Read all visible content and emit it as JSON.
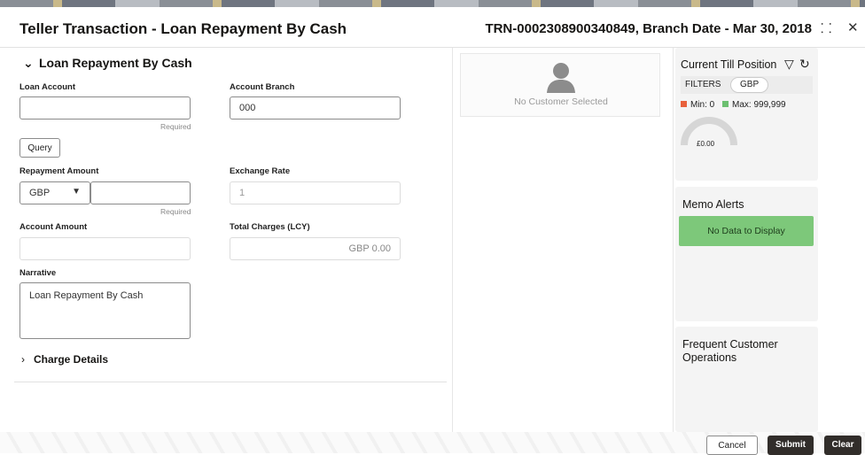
{
  "header": {
    "title": "Teller Transaction - Loan Repayment By Cash",
    "subtitle": "TRN-0002308900340849, Branch Date - Mar 30, 2018"
  },
  "form": {
    "section_title": "Loan Repayment By Cash",
    "loan_account_label": "Loan Account",
    "loan_account_value": "",
    "loan_account_hint": "Required",
    "account_branch_label": "Account Branch",
    "account_branch_value": "000",
    "query_label": "Query",
    "repayment_amount_label": "Repayment Amount",
    "currency": "GBP",
    "repayment_amount_value": "",
    "repayment_amount_hint": "Required",
    "exchange_rate_label": "Exchange Rate",
    "exchange_rate_value": "1",
    "account_amount_label": "Account Amount",
    "account_amount_value": "",
    "total_charges_label": "Total Charges (LCY)",
    "total_charges_value": "GBP 0.00",
    "narrative_label": "Narrative",
    "narrative_value": "Loan Repayment By Cash",
    "charge_details_label": "Charge Details"
  },
  "customer": {
    "empty_text": "No Customer Selected"
  },
  "till": {
    "title": "Current Till Position",
    "filters_label": "FILTERS",
    "filter_chip": "GBP",
    "min_label": "Min: 0",
    "max_label": "Max: 999,999",
    "min_color": "#e8613c",
    "max_color": "#6cc070",
    "gauge_value": "£0.00"
  },
  "memo": {
    "title": "Memo Alerts",
    "empty_text": "No Data to Display"
  },
  "frequent": {
    "title": "Frequent Customer Operations"
  },
  "footer": {
    "cancel": "Cancel",
    "submit": "Submit",
    "clear": "Clear"
  }
}
